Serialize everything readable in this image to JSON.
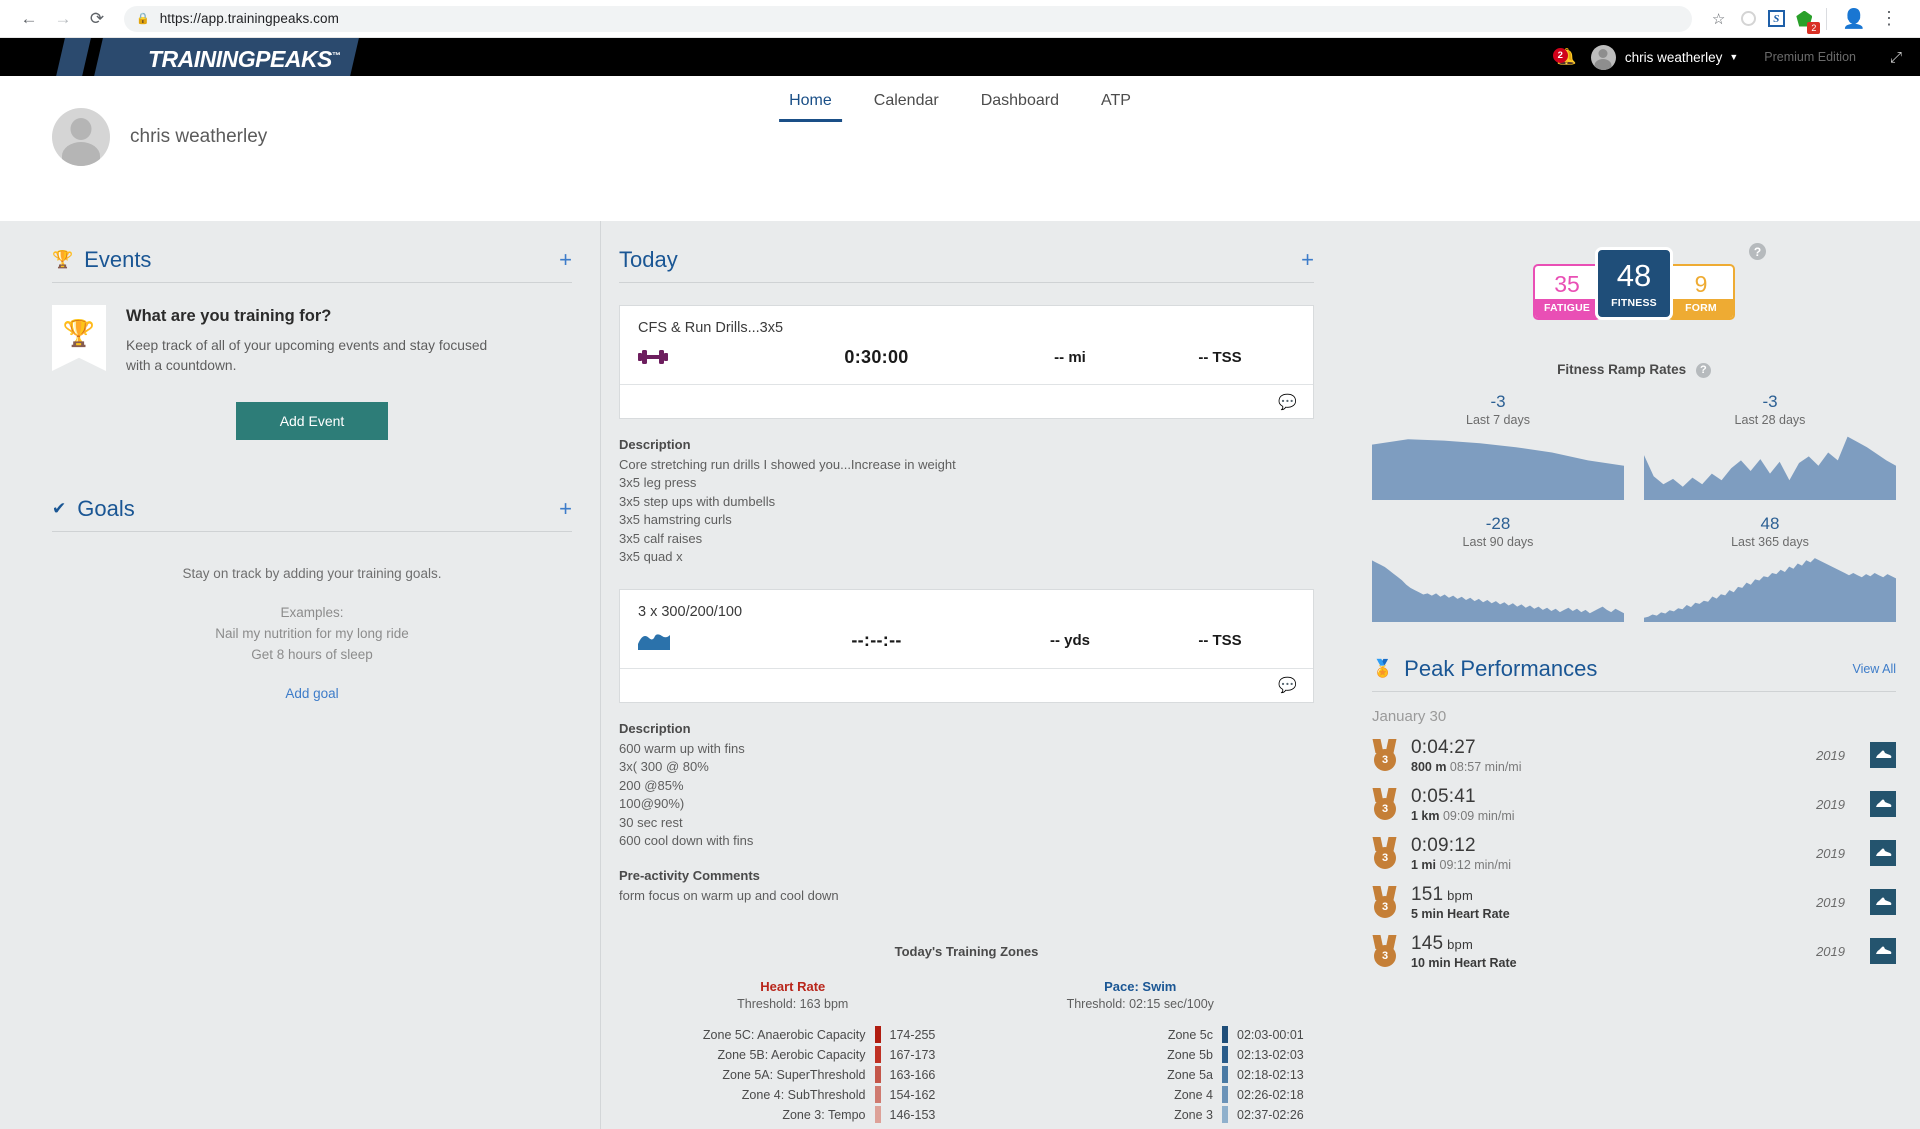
{
  "browser": {
    "back_icon": "←",
    "forward_icon": "→",
    "reload_icon": "⟳",
    "lock_icon": "🔒",
    "url": "https://app.trainingpeaks.com",
    "star_icon": "☆",
    "extension_badge": "2",
    "profile_icon": "account-circle",
    "menu_icon": "⋮"
  },
  "header": {
    "logo_text": "TRAININGPEAKS",
    "logo_tm": "™",
    "notification_count": "2",
    "user_name": "chris weatherley",
    "caret": "▼",
    "edition": "Premium Edition",
    "expand_icon": "⤢"
  },
  "nav": {
    "tabs": [
      {
        "label": "Home",
        "active": true
      },
      {
        "label": "Calendar",
        "active": false
      },
      {
        "label": "Dashboard",
        "active": false
      },
      {
        "label": "ATP",
        "active": false
      }
    ],
    "profile_name": "chris weatherley"
  },
  "events": {
    "title": "Events",
    "plus": "+",
    "card_title": "What are you training for?",
    "card_desc": "Keep track of all of your upcoming events and stay focused with a countdown.",
    "button_label": "Add Event"
  },
  "goals": {
    "title": "Goals",
    "plus": "+",
    "prompt": "Stay on track by adding your training goals.",
    "examples_label": "Examples:",
    "example_1": "Nail my nutrition for my long ride",
    "example_2": "Get 8 hours of sleep",
    "add_link": "Add goal"
  },
  "today": {
    "title": "Today",
    "plus": "+",
    "workouts": [
      {
        "name": "CFS & Run Drills...3x5",
        "icon": "dumbbell-icon",
        "duration": "0:30:00",
        "distance": "-- mi",
        "tss": "-- TSS",
        "description_label": "Description",
        "description": "Core stretching run drills I showed you...Increase in weight\n3x5 leg press\n3x5 step ups with dumbells\n3x5 hamstring curls\n3x5 calf raises\n3x5 quad x"
      },
      {
        "name": "3 x 300/200/100",
        "icon": "swim-wave-icon",
        "duration": "--:--:--",
        "distance": "-- yds",
        "tss": "-- TSS",
        "description_label": "Description",
        "description": "600 warm up with fins\n3x( 300 @ 80%\n200 @85%\n100@90%)\n30 sec rest\n600 cool down with fins",
        "comments_label": "Pre-activity Comments",
        "comments": "form focus on warm up and cool down"
      }
    ],
    "zones_title": "Today's Training Zones",
    "zones": [
      {
        "heading": "Heart Rate",
        "threshold": "Threshold: 163 bpm",
        "rows": [
          {
            "name": "Zone 5C: Anaerobic Capacity",
            "value": "174-255",
            "color": "#b01c10"
          },
          {
            "name": "Zone 5B: Aerobic Capacity",
            "value": "167-173",
            "color": "#bf3124"
          },
          {
            "name": "Zone 5A: SuperThreshold",
            "value": "163-166",
            "color": "#c4564a"
          },
          {
            "name": "Zone 4: SubThreshold",
            "value": "154-162",
            "color": "#cf7a70"
          },
          {
            "name": "Zone 3: Tempo",
            "value": "146-153",
            "color": "#dda198"
          }
        ]
      },
      {
        "heading": "Pace: Swim",
        "threshold": "Threshold: 02:15 sec/100y",
        "rows": [
          {
            "name": "Zone 5c",
            "value": "02:03-00:01",
            "color": "#1f4e79"
          },
          {
            "name": "Zone 5b",
            "value": "02:13-02:03",
            "color": "#2a5c8a"
          },
          {
            "name": "Zone 5a",
            "value": "02:18-02:13",
            "color": "#4a7aa4"
          },
          {
            "name": "Zone 4",
            "value": "02:26-02:18",
            "color": "#6b93b8"
          },
          {
            "name": "Zone 3",
            "value": "02:37-02:26",
            "color": "#8fb0cc"
          }
        ]
      }
    ]
  },
  "metrics": {
    "fatigue_value": "35",
    "fatigue_label": "FATIGUE",
    "fitness_value": "48",
    "fitness_label": "FITNESS",
    "form_value": "9",
    "form_label": "FORM",
    "help_icon": "?",
    "colors": {
      "fatigue": "#e94fb5",
      "fitness": "#1f4e79",
      "form": "#eeab33"
    }
  },
  "ramp": {
    "title": "Fitness Ramp Rates",
    "help_icon": "?",
    "cells": [
      {
        "value": "-3",
        "label": "Last 7 days"
      },
      {
        "value": "-3",
        "label": "Last 28 days"
      },
      {
        "value": "-28",
        "label": "Last 90 days"
      },
      {
        "value": "48",
        "label": "Last 365 days"
      }
    ]
  },
  "peaks": {
    "title": "Peak Performances",
    "view_all": "View All",
    "date": "January 30",
    "rows": [
      {
        "medal": "3",
        "value": "0:04:27",
        "unit": "",
        "sub_bold": "800 m",
        "sub": "08:57 min/mi",
        "year": "2019",
        "sport": "run-shoe-icon"
      },
      {
        "medal": "3",
        "value": "0:05:41",
        "unit": "",
        "sub_bold": "1 km",
        "sub": "09:09 min/mi",
        "year": "2019",
        "sport": "run-shoe-icon"
      },
      {
        "medal": "3",
        "value": "0:09:12",
        "unit": "",
        "sub_bold": "1 mi",
        "sub": "09:12 min/mi",
        "year": "2019",
        "sport": "run-shoe-icon"
      },
      {
        "medal": "3",
        "value": "151",
        "unit": " bpm",
        "sub_bold": "5 min Heart Rate",
        "sub": "",
        "year": "2019",
        "sport": "run-shoe-icon"
      },
      {
        "medal": "3",
        "value": "145",
        "unit": " bpm",
        "sub_bold": "10 min Heart Rate",
        "sub": "",
        "year": "2019",
        "sport": "run-shoe-icon"
      }
    ]
  },
  "chart_data": [
    {
      "type": "area",
      "title": "Last 7 days",
      "value": -3,
      "values": [
        42,
        46,
        45,
        43,
        40,
        36,
        30,
        26
      ],
      "ylim": [
        0,
        50
      ]
    },
    {
      "type": "area",
      "title": "Last 28 days",
      "value": -3,
      "values": [
        34,
        18,
        12,
        16,
        10,
        17,
        12,
        20,
        15,
        24,
        30,
        22,
        31,
        20,
        29,
        15,
        28,
        33,
        26,
        36,
        30,
        48,
        44,
        40,
        35,
        30,
        26
      ],
      "ylim": [
        0,
        50
      ]
    },
    {
      "type": "area",
      "title": "Last 90 days",
      "value": -28,
      "values": [
        56,
        54,
        52,
        50,
        47,
        44,
        41,
        38,
        34,
        31,
        29,
        27,
        25,
        26,
        24,
        26,
        23,
        25,
        22,
        24,
        21,
        23,
        20,
        22,
        19,
        21,
        18,
        20,
        17,
        19,
        16,
        18,
        15,
        17,
        14,
        16,
        13,
        15,
        12,
        14,
        11,
        13,
        10,
        12,
        9,
        11,
        13,
        10,
        12,
        9,
        11,
        8,
        10,
        12,
        14,
        11,
        9,
        12,
        10,
        8
      ],
      "ylim": [
        0,
        60
      ]
    },
    {
      "type": "area",
      "title": "Last 365 days",
      "value": 48,
      "values": [
        4,
        5,
        7,
        6,
        9,
        8,
        11,
        10,
        13,
        12,
        16,
        14,
        18,
        17,
        20,
        19,
        24,
        22,
        26,
        25,
        30,
        28,
        33,
        32,
        37,
        35,
        40,
        39,
        43,
        42,
        46,
        45,
        49,
        47,
        52,
        50,
        55,
        53,
        58,
        56,
        60,
        58,
        56,
        54,
        52,
        50,
        48,
        46,
        44,
        46,
        44,
        42,
        45,
        43,
        46,
        44,
        42,
        45,
        43,
        41
      ],
      "ylim": [
        0,
        62
      ]
    }
  ]
}
